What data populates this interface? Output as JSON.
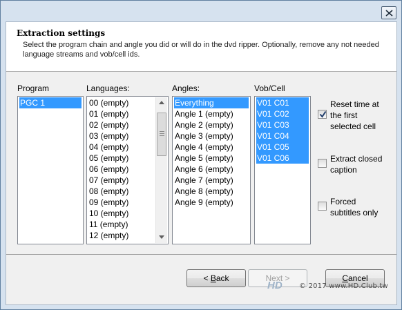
{
  "header": {
    "title": "Extraction settings",
    "description": "Select the program chain and angle you did or will do in the dvd ripper. Optionally, remove any not needed language streams and vob/cell ids."
  },
  "program": {
    "label": "Program",
    "items": [
      {
        "text": "PGC 1",
        "selected": true
      }
    ]
  },
  "languages": {
    "label": "Languages:",
    "items": [
      {
        "text": "00 (empty)",
        "selected": false
      },
      {
        "text": "01 (empty)",
        "selected": false
      },
      {
        "text": "02 (empty)",
        "selected": false
      },
      {
        "text": "03 (empty)",
        "selected": false
      },
      {
        "text": "04 (empty)",
        "selected": false
      },
      {
        "text": "05 (empty)",
        "selected": false
      },
      {
        "text": "06 (empty)",
        "selected": false
      },
      {
        "text": "07 (empty)",
        "selected": false
      },
      {
        "text": "08 (empty)",
        "selected": false
      },
      {
        "text": "09 (empty)",
        "selected": false
      },
      {
        "text": "10 (empty)",
        "selected": false
      },
      {
        "text": "11 (empty)",
        "selected": false
      },
      {
        "text": "12 (empty)",
        "selected": false
      }
    ]
  },
  "angles": {
    "label": "Angles:",
    "items": [
      {
        "text": "Everything",
        "selected": true
      },
      {
        "text": "Angle 1 (empty)",
        "selected": false
      },
      {
        "text": "Angle 2 (empty)",
        "selected": false
      },
      {
        "text": "Angle 3 (empty)",
        "selected": false
      },
      {
        "text": "Angle 4 (empty)",
        "selected": false
      },
      {
        "text": "Angle 5 (empty)",
        "selected": false
      },
      {
        "text": "Angle 6 (empty)",
        "selected": false
      },
      {
        "text": "Angle 7 (empty)",
        "selected": false
      },
      {
        "text": "Angle 8 (empty)",
        "selected": false
      },
      {
        "text": "Angle 9 (empty)",
        "selected": false
      }
    ]
  },
  "vobcell": {
    "label": "Vob/Cell",
    "items": [
      {
        "text": "V01 C01",
        "selected": true
      },
      {
        "text": "V01 C02",
        "selected": true
      },
      {
        "text": "V01 C03",
        "selected": true
      },
      {
        "text": "V01 C04",
        "selected": true
      },
      {
        "text": "V01 C05",
        "selected": true
      },
      {
        "text": "V01 C06",
        "selected": true
      }
    ]
  },
  "options": {
    "reset_time": {
      "label": "Reset time at the first selected cell",
      "checked": true
    },
    "closed_caption": {
      "label": "Extract closed caption",
      "checked": false
    },
    "forced_subs": {
      "label": "Forced subtitles only",
      "checked": false
    }
  },
  "buttons": {
    "back": {
      "mnemonic": "B",
      "rest": "ack",
      "prefix": "< "
    },
    "next": {
      "label": "Next >"
    },
    "cancel": {
      "mnemonic": "C",
      "rest": "ancel"
    }
  },
  "watermark": {
    "logo": "HD",
    "text": "© 2017 www.HD.Club.tw"
  },
  "colors": {
    "selection": "#3399ff",
    "window_frame": "#d6e2ef"
  }
}
